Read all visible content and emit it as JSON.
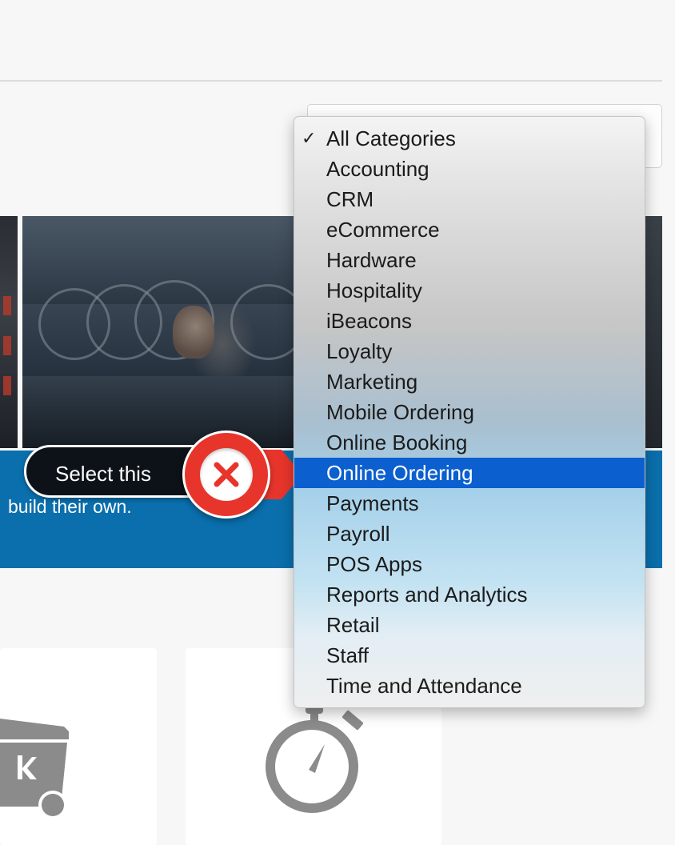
{
  "category_select": {
    "options": [
      "All Categories",
      "Accounting",
      "CRM",
      "eCommerce",
      "Hardware",
      "Hospitality",
      "iBeacons",
      "Loyalty",
      "Marketing",
      "Mobile Ordering",
      "Online Booking",
      "Online Ordering",
      "Payments",
      "Payroll",
      "POS Apps",
      "Reports and Analytics",
      "Retail",
      "Staff",
      "Time and Attendance"
    ],
    "checked_option": "All Categories",
    "checkmark": "✓",
    "highlighted_option": "Online Ordering",
    "highlight_color": "#0b5fcf"
  },
  "banner": {
    "text": "build their own.",
    "background_color": "#0a6fac"
  },
  "tooltip": {
    "label": "Select this",
    "accent_color": "#e8352c",
    "icon": "close-icon"
  },
  "cards": {
    "icons": [
      "trash-bin-icon",
      "stopwatch-icon"
    ]
  }
}
